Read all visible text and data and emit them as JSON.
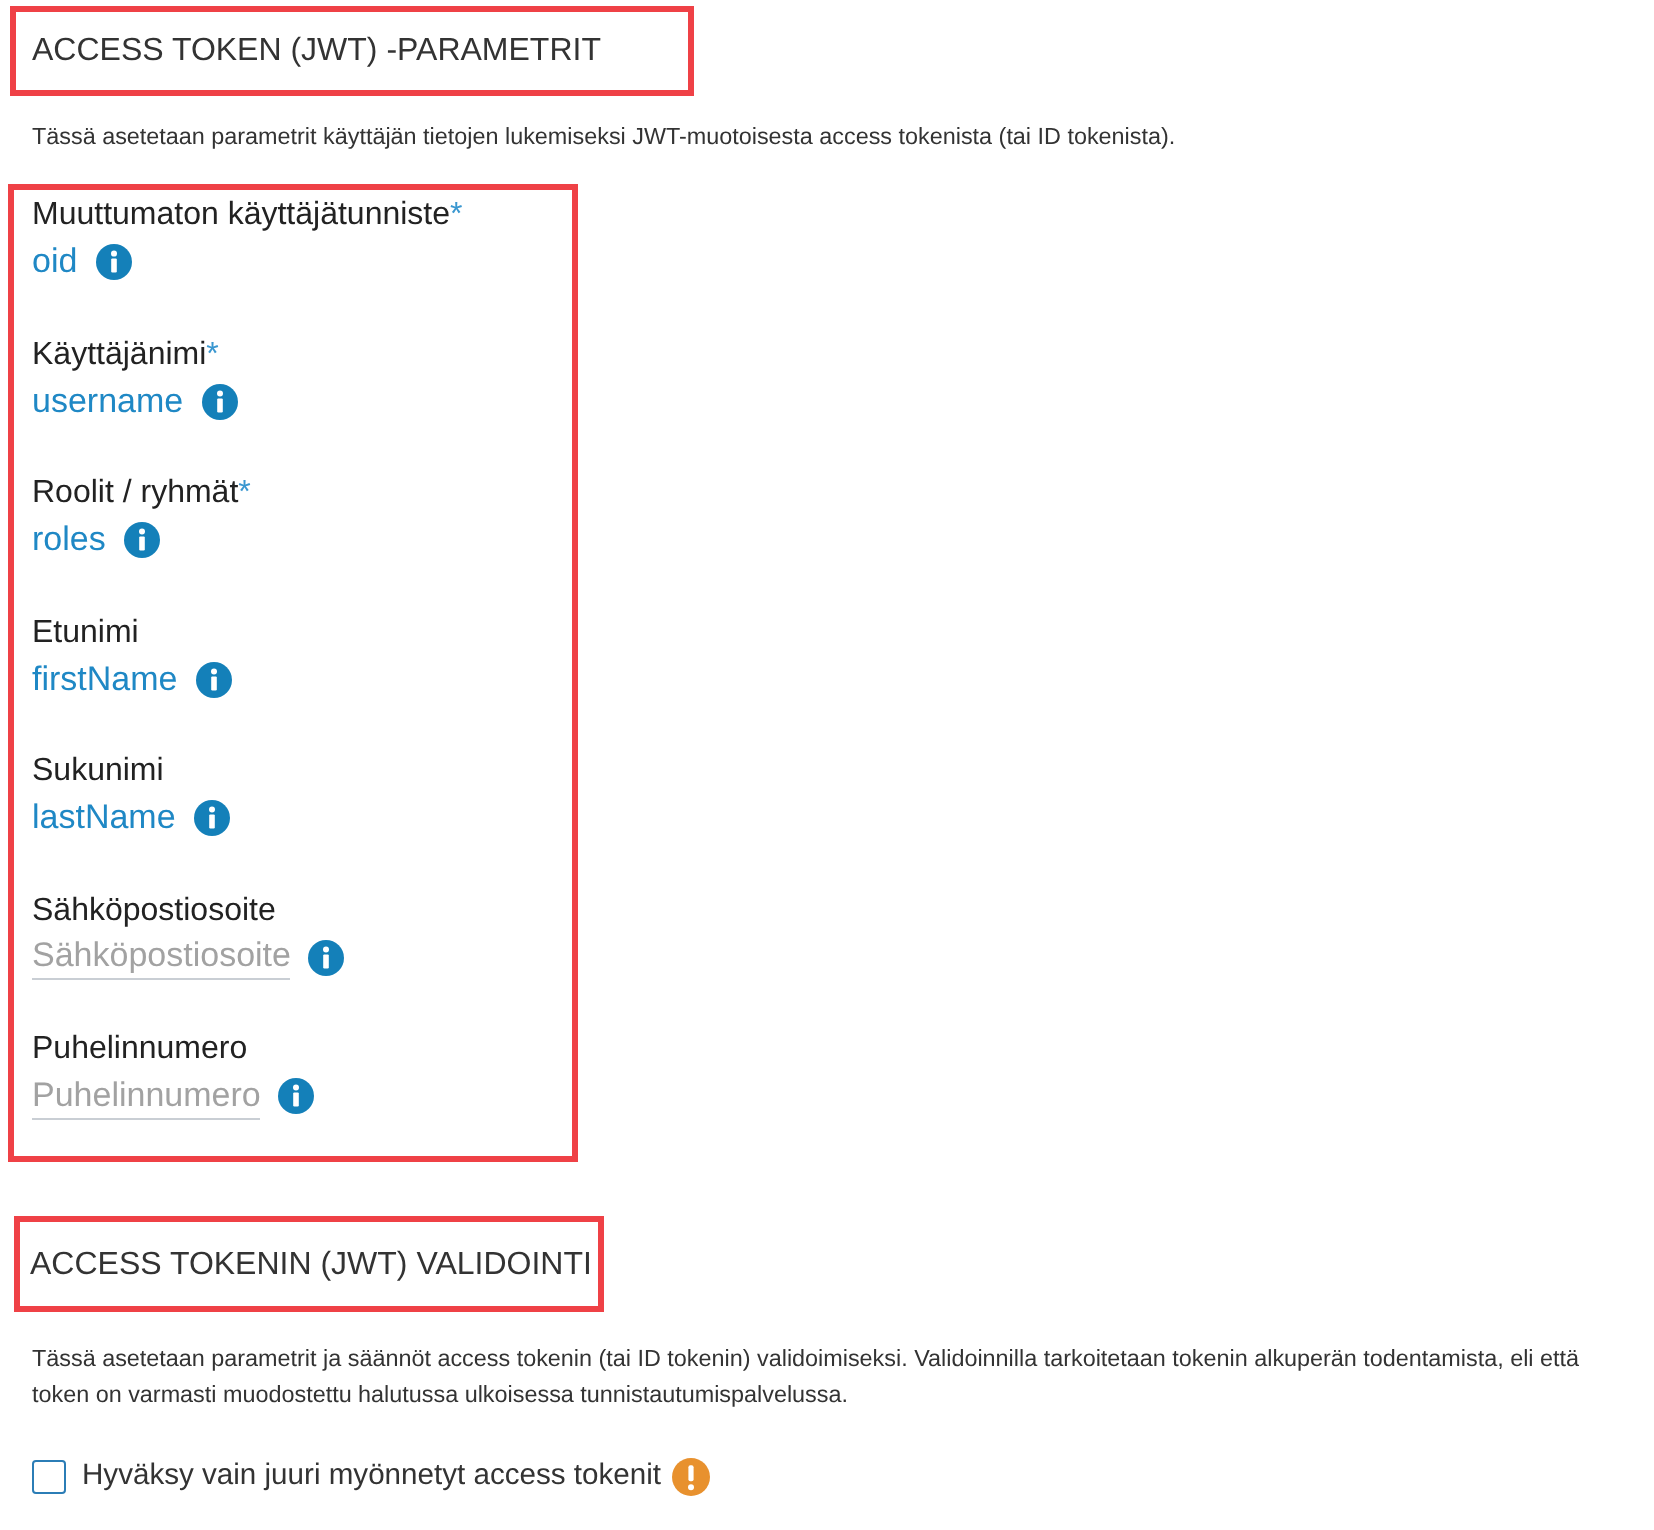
{
  "parameters": {
    "title": "ACCESS TOKEN (JWT) -PARAMETRIT",
    "title_highlighted": true,
    "description": "Tässä asetetaan parametrit käyttäjän tietojen lukemiseksi JWT-muotoisesta access tokenista (tai ID tokenista).",
    "fields_highlighted": true,
    "fields": [
      {
        "label": "Muuttumaton käyttäjätunniste",
        "required_mark": "*",
        "value": "oid"
      },
      {
        "label": "Käyttäjänimi",
        "required_mark": "*",
        "value": "username"
      },
      {
        "label": "Roolit / ryhmät",
        "required_mark": "*",
        "value": "roles"
      },
      {
        "label": "Etunimi",
        "value": "firstName"
      },
      {
        "label": "Sukunimi",
        "value": "lastName"
      },
      {
        "label": "Sähköpostiosoite",
        "placeholder": "Sähköpostiosoite"
      },
      {
        "label": "Puhelinnumero",
        "placeholder": "Puhelinnumero"
      }
    ]
  },
  "validation": {
    "title": "ACCESS TOKENIN (JWT) VALIDOINTI",
    "title_highlighted": true,
    "description": "Tässä asetetaan parametrit ja säännöt access tokenin (tai ID tokenin) validoimiseksi. Validoinnilla tarkoitetaan tokenin alkuperän todentamista, eli että token on varmasti muodostettu halutussa ulkoisessa tunnistautumispalvelussa.",
    "options": [
      {
        "label": "Hyväksy vain juuri myönnetyt access tokenit",
        "checked": false
      }
    ]
  }
}
